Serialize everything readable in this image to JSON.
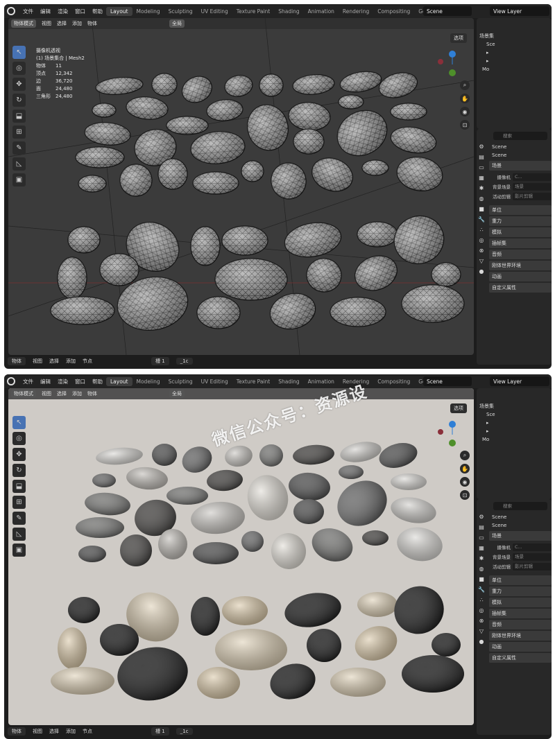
{
  "menu": [
    "文件",
    "编辑",
    "渲染",
    "窗口",
    "帮助"
  ],
  "workspaces": [
    "Layout",
    "Modeling",
    "Sculpting",
    "UV Editing",
    "Texture Paint",
    "Shading",
    "Animation",
    "Rendering",
    "Compositing",
    "Geometry No"
  ],
  "scene_name": "Scene",
  "view_layer": "View Layer",
  "viewport": {
    "mode": "物体模式",
    "view": "视图",
    "select": "选择",
    "add": "添加",
    "object": "物体",
    "global": "全局",
    "selectable": "选项"
  },
  "info": {
    "line1": "摄像机透视",
    "line2": "(1) 场景集合 | Mesh2",
    "stats": [
      [
        "物体",
        "11"
      ],
      [
        "顶点",
        "12,342"
      ],
      [
        "边",
        "36,720"
      ],
      [
        "面",
        "24,480"
      ],
      [
        "三角形",
        "24,480"
      ]
    ]
  },
  "bottom": {
    "mode": "物体",
    "view": "视图",
    "select": "选择",
    "add": "添加",
    "node": "节点",
    "slot": "槽 1",
    "material": "_1c"
  },
  "outliner": {
    "title": "场景集",
    "items": [
      "Sce",
      "",
      "",
      "Mo"
    ]
  },
  "properties": {
    "search": "搜索",
    "scene": "Scene",
    "scene_field": "Scene",
    "section_scene": "场景",
    "camera_lbl": "摄像机",
    "camera_val": "C...",
    "bg_lbl": "背景场景",
    "bg_val": "场景",
    "clip_lbl": "活动剪辑",
    "clip_val": "影片剪辑",
    "sections": [
      "单位",
      "重力",
      "模拟",
      "插帧集",
      "音频",
      "刚体世界环境",
      "动画",
      "自定义属性"
    ]
  },
  "watermark": "微信公众号：资源设"
}
